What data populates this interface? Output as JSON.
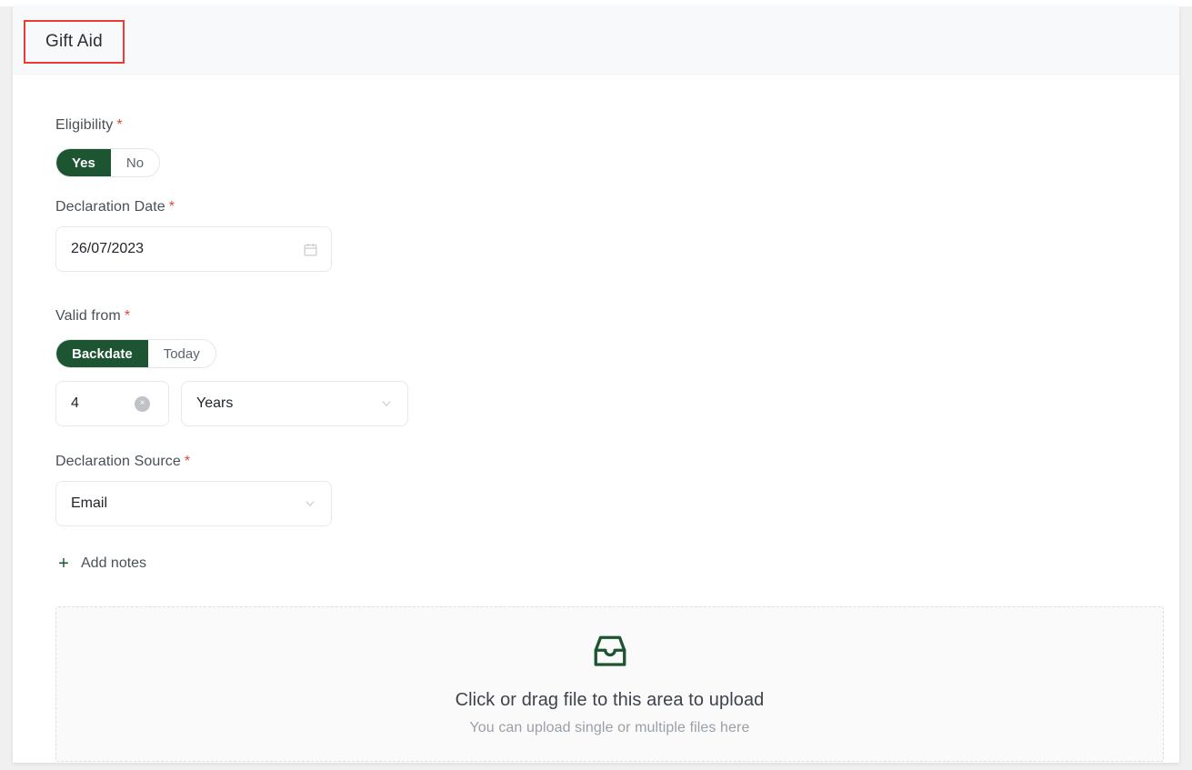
{
  "tab": {
    "label": "Gift Aid"
  },
  "form": {
    "eligibility": {
      "label": "Eligibility",
      "required": "*",
      "options": [
        "Yes",
        "No"
      ],
      "selected": "Yes"
    },
    "declaration_date": {
      "label": "Declaration Date",
      "required": "*",
      "value": "26/07/2023",
      "icon": "calendar-icon"
    },
    "valid_from": {
      "label": "Valid from",
      "required": "*",
      "options": [
        "Backdate",
        "Today"
      ],
      "selected": "Backdate",
      "amount_value": "4",
      "clear_glyph": "×",
      "unit_value": "Years",
      "unit_icon": "chevron-down-icon"
    },
    "declaration_source": {
      "label": "Declaration Source",
      "required": "*",
      "value": "Email",
      "icon": "chevron-down-icon"
    },
    "add_notes": {
      "label": "Add notes",
      "icon": "plus-icon",
      "glyph": "+"
    },
    "upload": {
      "icon": "inbox-icon",
      "title": "Click or drag file to this area to upload",
      "subtitle": "You can upload single or multiple files here"
    }
  },
  "colors": {
    "accent_green": "#1d5532",
    "required_red": "#e8453c",
    "highlight_red": "#ee3b33",
    "header_bg": "#f8f9fb",
    "dropzone_bg": "#fafafa"
  }
}
